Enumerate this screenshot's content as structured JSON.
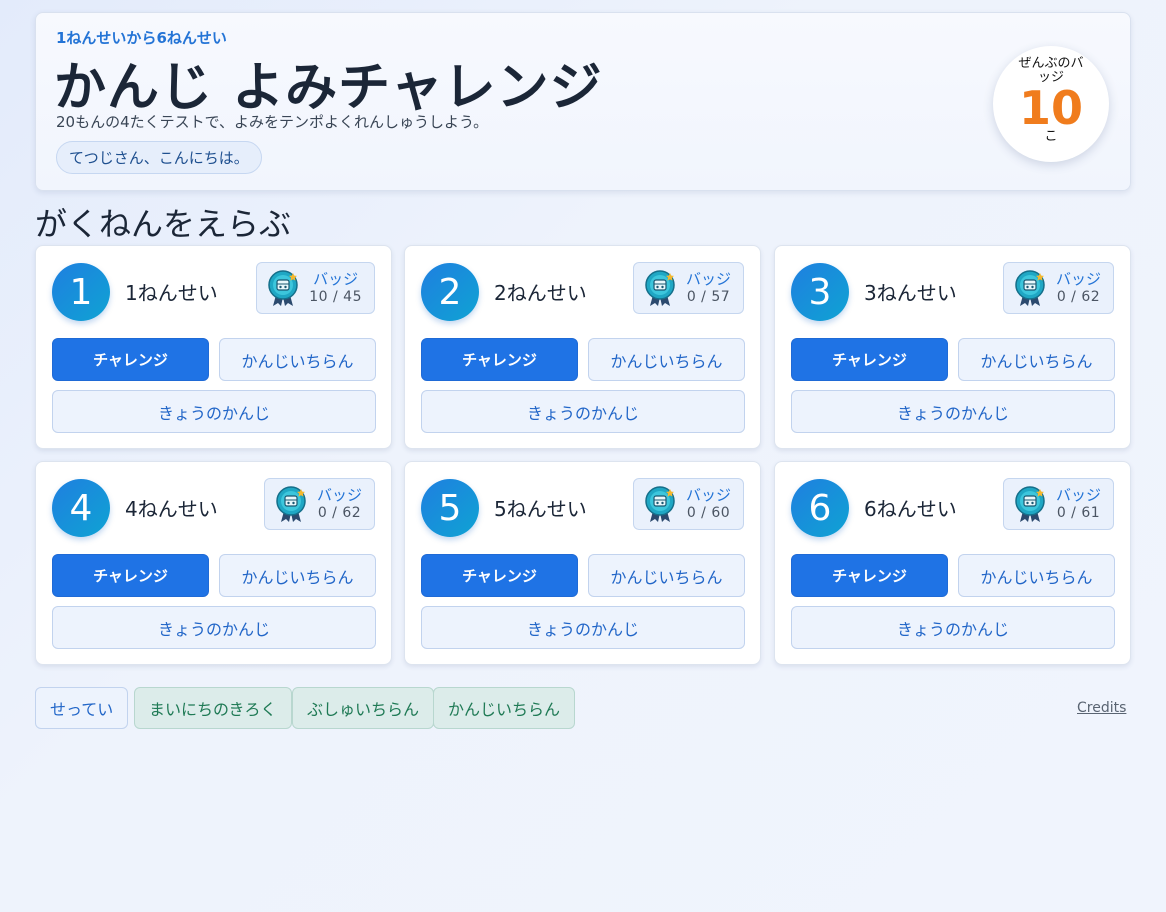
{
  "header": {
    "subtitle": "1ねんせいから6ねんせい",
    "title": "かんじ よみチャレンジ",
    "description": "20もんの4たくテストで、よみをテンポよくれんしゅうしよう。",
    "greeting": "てつじさん、こんにちは。",
    "total_badges": {
      "label": "ぜんぶのバッジ",
      "count": "10",
      "unit": "こ"
    }
  },
  "section_title": "がくねんをえらぶ",
  "grades": [
    {
      "number": "1",
      "name": "1ねんせい",
      "badge_label": "バッジ",
      "badge_count": "10 / 45",
      "challenge_label": "チャレンジ",
      "list_label": "かんじいちらん",
      "today_label": "きょうのかんじ"
    },
    {
      "number": "2",
      "name": "2ねんせい",
      "badge_label": "バッジ",
      "badge_count": "0 / 57",
      "challenge_label": "チャレンジ",
      "list_label": "かんじいちらん",
      "today_label": "きょうのかんじ"
    },
    {
      "number": "3",
      "name": "3ねんせい",
      "badge_label": "バッジ",
      "badge_count": "0 / 62",
      "challenge_label": "チャレンジ",
      "list_label": "かんじいちらん",
      "today_label": "きょうのかんじ"
    },
    {
      "number": "4",
      "name": "4ねんせい",
      "badge_label": "バッジ",
      "badge_count": "0 / 62",
      "challenge_label": "チャレンジ",
      "list_label": "かんじいちらん",
      "today_label": "きょうのかんじ"
    },
    {
      "number": "5",
      "name": "5ねんせい",
      "badge_label": "バッジ",
      "badge_count": "0 / 60",
      "challenge_label": "チャレンジ",
      "list_label": "かんじいちらん",
      "today_label": "きょうのかんじ"
    },
    {
      "number": "6",
      "name": "6ねんせい",
      "badge_label": "バッジ",
      "badge_count": "0 / 61",
      "challenge_label": "チャレンジ",
      "list_label": "かんじいちらん",
      "today_label": "きょうのかんじ"
    }
  ],
  "footer": {
    "settings": "せってい",
    "daily_record": "まいにちのきろく",
    "radical_list": "ぶしゅいちらん",
    "kanji_list": "かんじいちらん",
    "credits": "Credits"
  },
  "colors": {
    "accent": "#1f73e5",
    "badge_total": "#f07c1d",
    "footer_green": "#1f7a55"
  },
  "icons": {
    "badge": "medal-badge-icon"
  }
}
